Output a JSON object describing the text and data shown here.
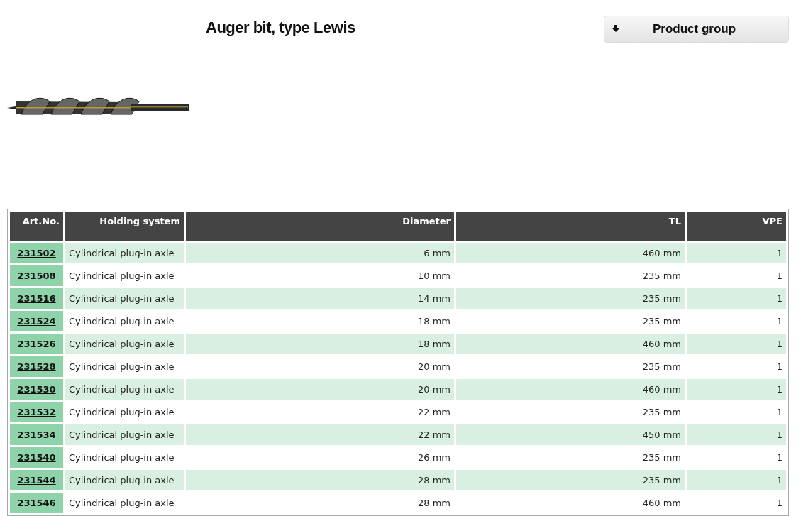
{
  "title": "Auger bit, type Lewis",
  "product_group_button": {
    "label": "Product group"
  },
  "table": {
    "columns": [
      "Art.No.",
      "Holding system",
      "Diameter",
      "TL",
      "VPE"
    ],
    "rows": [
      [
        "231502",
        "Cylindrical plug-in axle",
        "6 mm",
        "460 mm",
        "1"
      ],
      [
        "231508",
        "Cylindrical plug-in axle",
        "10 mm",
        "235 mm",
        "1"
      ],
      [
        "231516",
        "Cylindrical plug-in axle",
        "14 mm",
        "235 mm",
        "1"
      ],
      [
        "231524",
        "Cylindrical plug-in axle",
        "18 mm",
        "235 mm",
        "1"
      ],
      [
        "231526",
        "Cylindrical plug-in axle",
        "18 mm",
        "460 mm",
        "1"
      ],
      [
        "231528",
        "Cylindrical plug-in axle",
        "20 mm",
        "235 mm",
        "1"
      ],
      [
        "231530",
        "Cylindrical plug-in axle",
        "20 mm",
        "460 mm",
        "1"
      ],
      [
        "231532",
        "Cylindrical plug-in axle",
        "22 mm",
        "235 mm",
        "1"
      ],
      [
        "231534",
        "Cylindrical plug-in axle",
        "22 mm",
        "450 mm",
        "1"
      ],
      [
        "231540",
        "Cylindrical plug-in axle",
        "26 mm",
        "235 mm",
        "1"
      ],
      [
        "231544",
        "Cylindrical plug-in axle",
        "28 mm",
        "235 mm",
        "1"
      ],
      [
        "231546",
        "Cylindrical plug-in axle",
        "28 mm",
        "460 mm",
        "1"
      ]
    ]
  }
}
